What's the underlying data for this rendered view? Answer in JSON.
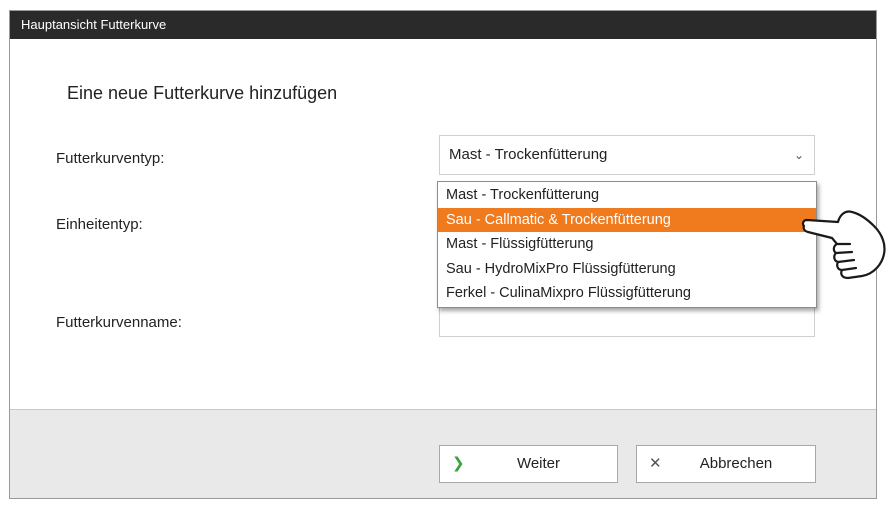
{
  "window": {
    "title": "Hauptansicht Futterkurve"
  },
  "form": {
    "heading": "Eine neue Futterkurve hinzufügen",
    "feed_curve_type_label": "Futterkurventyp:",
    "unit_type_label": "Einheitentyp:",
    "feed_curve_name_label": "Futterkurvenname:",
    "feed_curve_type_value": "Mast - Trockenfütterung"
  },
  "dropdown": {
    "options": [
      "Mast - Trockenfütterung",
      "Sau - Callmatic & Trockenfütterung",
      "Mast - Flüssigfütterung",
      "Sau - HydroMixPro Flüssigfütterung",
      "Ferkel - CulinaMixpro Flüssigfütterung"
    ],
    "highlighted_index": 1
  },
  "buttons": {
    "next_label": "Weiter",
    "cancel_label": "Abbrechen"
  },
  "icons": {
    "select_chevron": "chevron-down-icon",
    "next": "chevron-right-icon",
    "cancel": "close-icon",
    "cursor": "pointing-hand-icon"
  },
  "colors": {
    "titlebar": "#2a2a2a",
    "highlight": "#f07a1e",
    "next_icon": "#3aa53a",
    "footer": "#e9e9e9"
  }
}
